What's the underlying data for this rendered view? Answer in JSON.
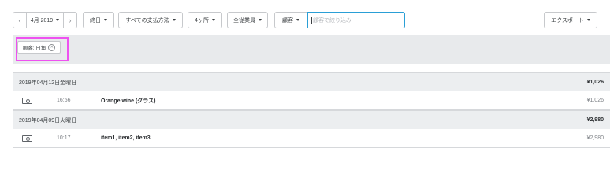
{
  "toolbar": {
    "prev_icon": "chevron-left-icon",
    "next_icon": "chevron-right-icon",
    "date_label": "4月 2019",
    "end_day_label": "終日",
    "payment_method_label": "すべての支払方法",
    "locations_label": "4ヶ所",
    "employees_label": "全従業員",
    "search_type_label": "顧客",
    "search_placeholder": "顧客で絞り込み",
    "export_label": "エクスポート"
  },
  "filters": {
    "active_chip": "顧客: 日角"
  },
  "days": [
    {
      "date": "2019年04月12日金曜日",
      "total": "¥1,026",
      "transactions": [
        {
          "icon": "cash-icon",
          "time": "16:56",
          "items": "Orange wine (グラス)",
          "amount": "¥1,026"
        }
      ]
    },
    {
      "date": "2019年04月09日火曜日",
      "total": "¥2,980",
      "transactions": [
        {
          "icon": "cash-icon",
          "time": "10:17",
          "items": "item1, item2, item3",
          "amount": "¥2,980"
        }
      ]
    }
  ],
  "colors": {
    "highlight": "#ee52f0",
    "focus": "#2a9fd6",
    "band": "#e8eaec"
  }
}
